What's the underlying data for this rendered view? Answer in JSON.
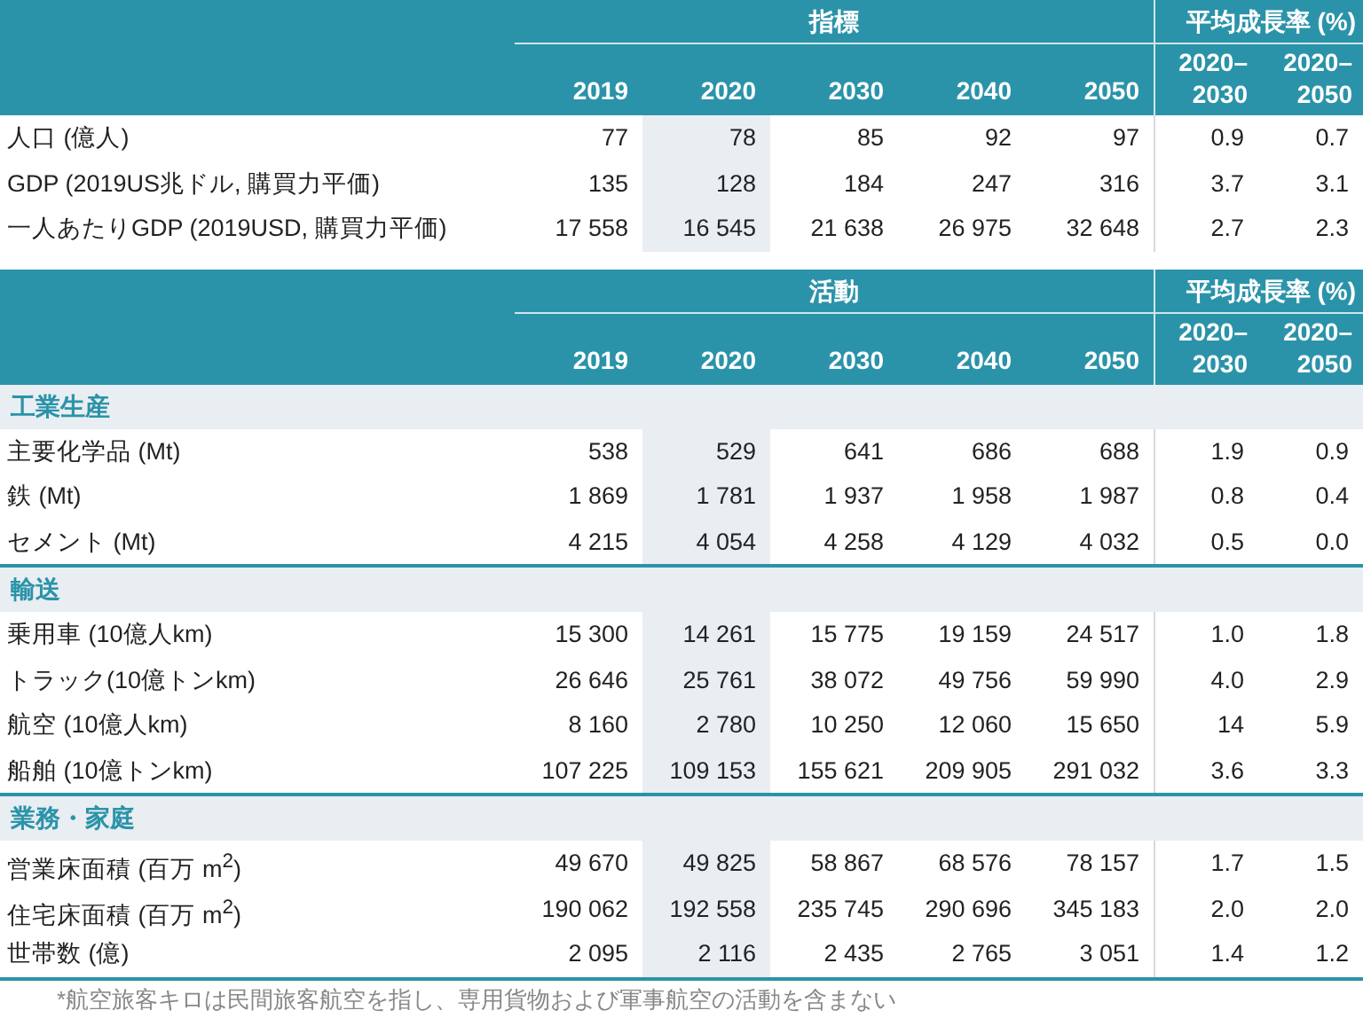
{
  "tables": [
    {
      "group_header": "指標",
      "growth_header": "平均成長率 (%)",
      "years": [
        {
          "label": "2019",
          "highlighted": false
        },
        {
          "label": "2020",
          "highlighted": true
        },
        {
          "label": "2030",
          "highlighted": false
        },
        {
          "label": "2040",
          "highlighted": false
        },
        {
          "label": "2050",
          "highlighted": false
        }
      ],
      "growth_periods": [
        "2020–2030",
        "2020–2050"
      ],
      "sections": [
        {
          "rows": [
            {
              "label": "人口 (億人)",
              "values": [
                "77",
                "78",
                "85",
                "92",
                "97"
              ],
              "growth": [
                "0.9",
                "0.7"
              ]
            },
            {
              "label": "GDP (2019US兆ドル, 購買力平価)",
              "values": [
                "135",
                "128",
                "184",
                "247",
                "316"
              ],
              "growth": [
                "3.7",
                "3.1"
              ]
            },
            {
              "label": "一人あたりGDP (2019USD, 購買力平価)",
              "values": [
                "17 558",
                "16 545",
                "21 638",
                "26 975",
                "32 648"
              ],
              "growth": [
                "2.7",
                "2.3"
              ]
            }
          ]
        }
      ]
    },
    {
      "group_header": "活動",
      "growth_header": "平均成長率 (%)",
      "years": [
        {
          "label": "2019",
          "highlighted": false
        },
        {
          "label": "2020",
          "highlighted": true
        },
        {
          "label": "2030",
          "highlighted": false
        },
        {
          "label": "2040",
          "highlighted": false
        },
        {
          "label": "2050",
          "highlighted": false
        }
      ],
      "growth_periods": [
        "2020–2030",
        "2020–2050"
      ],
      "sections": [
        {
          "title": "工業生産",
          "rows": [
            {
              "label": "主要化学品 (Mt)",
              "values": [
                "538",
                "529",
                "641",
                "686",
                "688"
              ],
              "growth": [
                "1.9",
                "0.9"
              ]
            },
            {
              "label": "鉄 (Mt)",
              "values": [
                "1 869",
                "1 781",
                "1 937",
                "1 958",
                "1 987"
              ],
              "growth": [
                "0.8",
                "0.4"
              ]
            },
            {
              "label": "セメント (Mt)",
              "values": [
                "4 215",
                "4 054",
                "4 258",
                "4 129",
                "4 032"
              ],
              "growth": [
                "0.5",
                "0.0"
              ]
            }
          ]
        },
        {
          "title": "輸送",
          "rows": [
            {
              "label": "乗用車 (10億人km)",
              "values": [
                "15 300",
                "14 261",
                "15 775",
                "19 159",
                "24 517"
              ],
              "growth": [
                "1.0",
                "1.8"
              ]
            },
            {
              "label": "トラック(10億トンkm)",
              "values": [
                "26 646",
                "25 761",
                "38 072",
                "49 756",
                "59 990"
              ],
              "growth": [
                "4.0",
                "2.9"
              ]
            },
            {
              "label": "航空 (10億人km)",
              "values": [
                "8 160",
                "2 780",
                "10 250",
                "12 060",
                "15 650"
              ],
              "growth": [
                "14",
                "5.9"
              ]
            },
            {
              "label": "船舶 (10億トンkm)",
              "values": [
                "107 225",
                "109 153",
                "155 621",
                "209 905",
                "291 032"
              ],
              "growth": [
                "3.6",
                "3.3"
              ]
            }
          ]
        },
        {
          "title": "業務・家庭",
          "rows": [
            {
              "label": "営業床面積 (百万 m$^{2}$)",
              "values": [
                "49 670",
                "49 825",
                "58 867",
                "68 576",
                "78 157"
              ],
              "growth": [
                "1.7",
                "1.5"
              ]
            },
            {
              "label": "住宅床面積 (百万 m$^{2}$)",
              "values": [
                "190 062",
                "192 558",
                "235 745",
                "290 696",
                "345 183"
              ],
              "growth": [
                "2.0",
                "2.0"
              ]
            },
            {
              "label": "世帯数 (億)",
              "values": [
                "2 095",
                "2 116",
                "2 435",
                "2 765",
                "3 051"
              ],
              "growth": [
                "1.4",
                "1.2"
              ]
            }
          ]
        }
      ]
    }
  ],
  "footnote": "*航空旅客キロは民間旅客航空を指し、専用貨物および軍事航空の活動を含まない"
}
